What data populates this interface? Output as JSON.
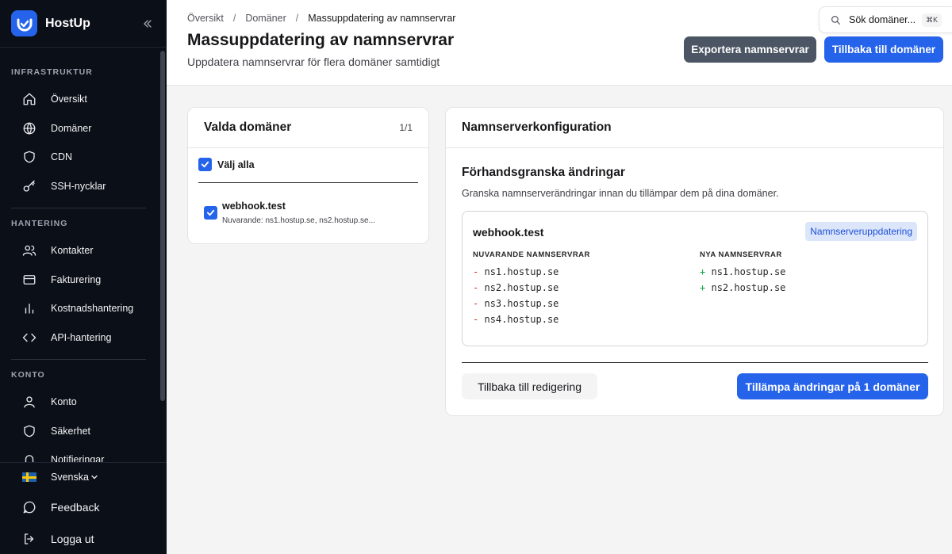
{
  "app": {
    "name": "HostUp"
  },
  "sidebar": {
    "sections": [
      {
        "title": "INFRASTRUKTUR",
        "items": [
          {
            "label": "Översikt",
            "icon": "home-icon"
          },
          {
            "label": "Domäner",
            "icon": "globe-icon"
          },
          {
            "label": "CDN",
            "icon": "shield-icon"
          },
          {
            "label": "SSH-nycklar",
            "icon": "key-icon"
          }
        ]
      },
      {
        "title": "HANTERING",
        "items": [
          {
            "label": "Kontakter",
            "icon": "users-icon"
          },
          {
            "label": "Fakturering",
            "icon": "credit-card-icon"
          },
          {
            "label": "Kostnadshantering",
            "icon": "bar-chart-icon"
          },
          {
            "label": "API-hantering",
            "icon": "code-icon"
          }
        ]
      },
      {
        "title": "KONTO",
        "items": [
          {
            "label": "Konto",
            "icon": "user-icon"
          },
          {
            "label": "Säkerhet",
            "icon": "shield-icon"
          },
          {
            "label": "Notifieringar",
            "icon": "bell-icon"
          }
        ]
      }
    ],
    "language": "Svenska",
    "feedback": "Feedback",
    "logout": "Logga ut"
  },
  "header": {
    "breadcrumbs": [
      "Översikt",
      "Domäner",
      "Massuppdatering av namnservrar"
    ],
    "title": "Massuppdatering av namnservrar",
    "subtitle": "Uppdatera namnservrar för flera domäner samtidigt",
    "search_placeholder": "Sök domäner...",
    "search_shortcut": "⌘K",
    "export_button": "Exportera namnservrar",
    "back_button": "Tillbaka till domäner"
  },
  "selected": {
    "title": "Valda domäner",
    "count": "1/1",
    "select_all": "Välj alla",
    "domains": [
      {
        "name": "webhook.test",
        "current": "Nuvarande: ns1.hostup.se, ns2.hostup.se..."
      }
    ]
  },
  "config": {
    "title": "Namnserverkonfiguration",
    "preview_title": "Förhandsgranska ändringar",
    "preview_desc": "Granska namnserverändringar innan du tillämpar dem på dina domäner.",
    "domain": "webhook.test",
    "badge": "Namnserveruppdatering",
    "current_header": "NUVARANDE NAMNSERVRAR",
    "new_header": "NYA NAMNSERVRAR",
    "current": [
      "ns1.hostup.se",
      "ns2.hostup.se",
      "ns3.hostup.se",
      "ns4.hostup.se"
    ],
    "new": [
      "ns1.hostup.se",
      "ns2.hostup.se"
    ],
    "minus_sign": "-",
    "plus_sign": "+",
    "back_edit": "Tillbaka till redigering",
    "apply": "Tillämpa ändringar på 1 domäner",
    "colors": {
      "accent": "#2563eb",
      "removed": "#dc2626",
      "added": "#16a34a"
    }
  }
}
